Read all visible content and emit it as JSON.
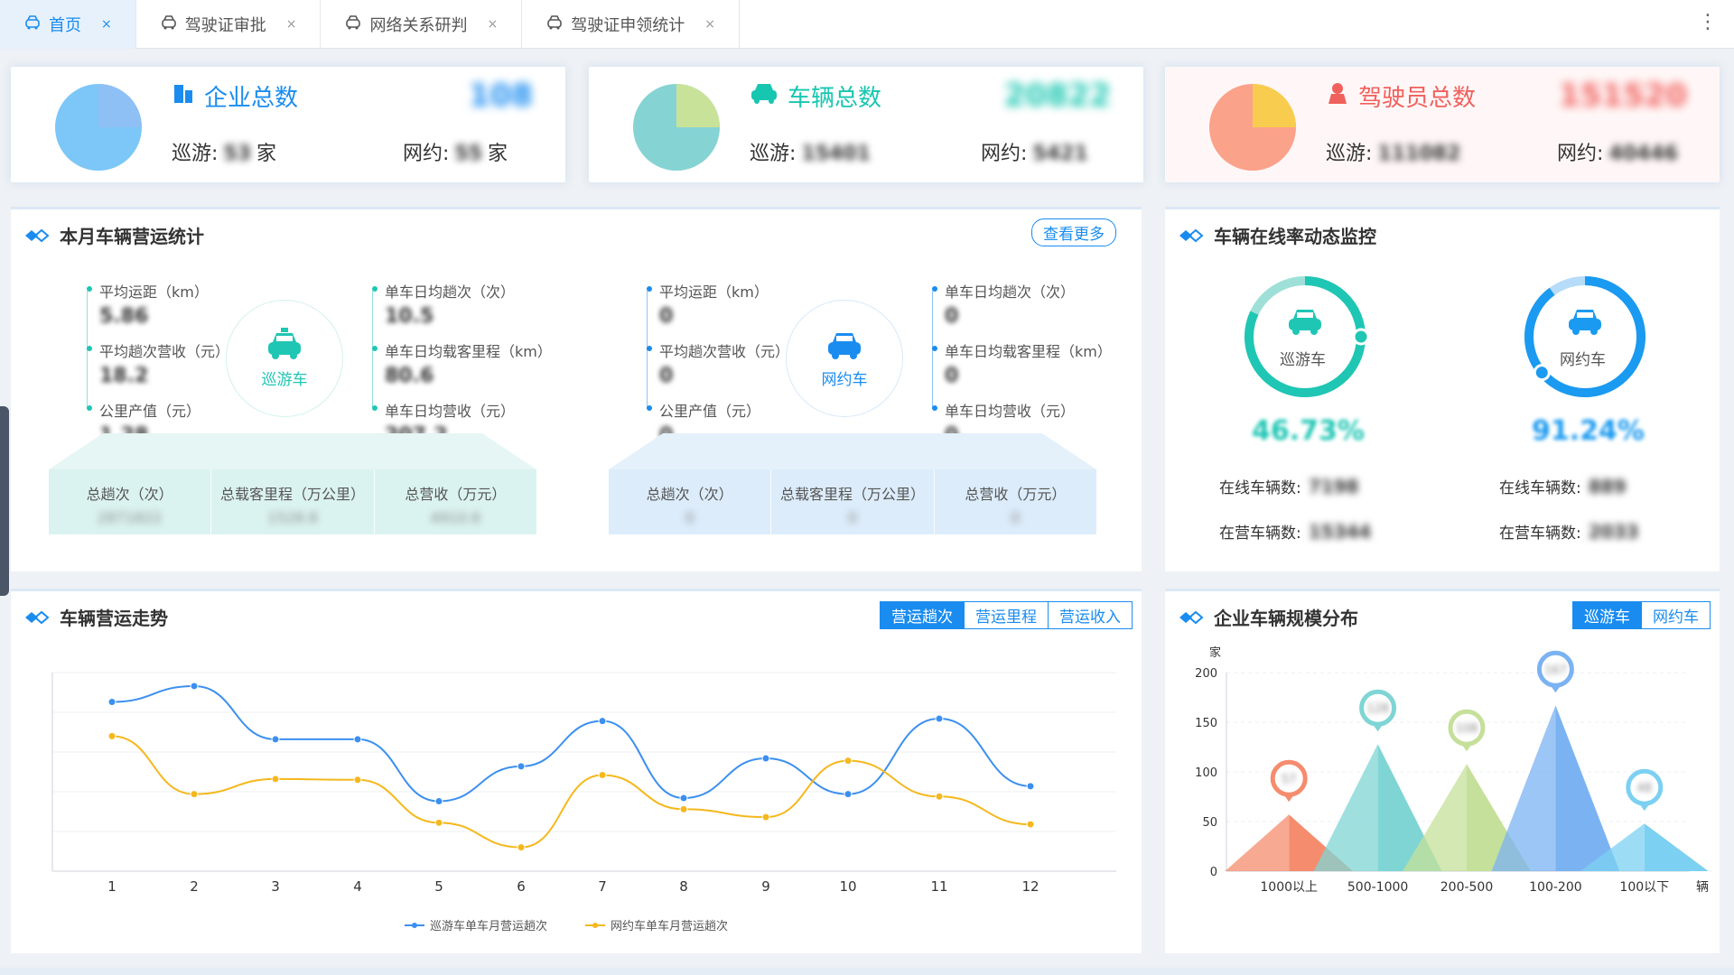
{
  "tabs": [
    {
      "label": "首页",
      "active": true
    },
    {
      "label": "驾驶证审批",
      "active": false
    },
    {
      "label": "网络关系研判",
      "active": false
    },
    {
      "label": "驾驶证申领统计",
      "active": false
    }
  ],
  "summary": [
    {
      "title": "企业总数",
      "total": "108",
      "left_label": "巡游:",
      "left_value": "53",
      "left_unit": "家",
      "right_label": "网约:",
      "right_value": "55",
      "right_unit": "家",
      "color": "#1a8cf0",
      "pie": [
        "#8ec0f5",
        "#7cc7f7"
      ]
    },
    {
      "title": "车辆总数",
      "total": "20822",
      "left_label": "巡游:",
      "left_value": "15401",
      "left_unit": "",
      "right_label": "网约:",
      "right_value": "5421",
      "right_unit": "",
      "color": "#17c6b0",
      "pie": [
        "#c8e29a",
        "#86d3d3"
      ]
    },
    {
      "title": "驾驶员总数",
      "total": "151520",
      "left_label": "巡游:",
      "left_value": "111082",
      "left_unit": "",
      "right_label": "网约:",
      "right_value": "40446",
      "right_unit": "",
      "color": "#f0605c",
      "pie": [
        "#f8cd4f",
        "#fba28a"
      ]
    }
  ],
  "ops": {
    "title": "本月车辆营运统计",
    "more": "查看更多",
    "groups": [
      {
        "name": "巡游车",
        "accent": "#1fc6b4",
        "left": [
          {
            "label": "平均运距（km）",
            "value": "5.86"
          },
          {
            "label": "平均趟次营收（元）",
            "value": "18.2"
          },
          {
            "label": "公里产值（元）",
            "value": "1.28"
          }
        ],
        "right": [
          {
            "label": "单车日均趟次（次）",
            "value": "10.5"
          },
          {
            "label": "单车日均载客里程（km）",
            "value": "80.6"
          },
          {
            "label": "单车日均营收（元）",
            "value": "207.2"
          }
        ],
        "totals": [
          {
            "label": "总趟次（次）",
            "value": "2871822"
          },
          {
            "label": "总载客里程（万公里）",
            "value": "1528.8"
          },
          {
            "label": "总营收（万元）",
            "value": "4910.6"
          }
        ]
      },
      {
        "name": "网约车",
        "accent": "#1a8cf0",
        "left": [
          {
            "label": "平均运距（km）",
            "value": "0"
          },
          {
            "label": "平均趟次营收（元）",
            "value": "0"
          },
          {
            "label": "公里产值（元）",
            "value": "0"
          }
        ],
        "right": [
          {
            "label": "单车日均趟次（次）",
            "value": "0"
          },
          {
            "label": "单车日均载客里程（km）",
            "value": "0"
          },
          {
            "label": "单车日均营收（元）",
            "value": "0"
          }
        ],
        "totals": [
          {
            "label": "总趟次（次）",
            "value": "0"
          },
          {
            "label": "总载客里程（万公里）",
            "value": "0"
          },
          {
            "label": "总营收（万元）",
            "value": "0"
          }
        ]
      }
    ]
  },
  "online": {
    "title": "车辆在线率动态监控",
    "gauges": [
      {
        "name": "巡游车",
        "pct": "46.73%",
        "pct_value": 0.82,
        "online_label": "在线车辆数:",
        "online": "7198",
        "oper_label": "在营车辆数:",
        "oper": "15344",
        "color": "#1fc6b4",
        "track": "#9ee0d8"
      },
      {
        "name": "网约车",
        "pct": "91.24%",
        "pct_value": 0.9,
        "online_label": "在线车辆数:",
        "online": "889",
        "oper_label": "在营车辆数:",
        "oper": "2033",
        "color": "#1a9af0",
        "track": "#b6dcf9"
      }
    ]
  },
  "trend": {
    "title": "车辆营运走势",
    "buttons": [
      "营运趟次",
      "营运里程",
      "营运收入"
    ],
    "active": 0
  },
  "scale": {
    "title": "企业车辆规模分布",
    "buttons": [
      "巡游车",
      "网约车"
    ],
    "active": 0
  },
  "chart_data": [
    {
      "type": "line",
      "x": [
        1,
        2,
        3,
        4,
        5,
        6,
        7,
        8,
        9,
        10,
        11,
        12
      ],
      "ylim": [
        0,
        250
      ],
      "series": [
        {
          "name": "巡游车单车月营运趟次",
          "color": "#3b8ff0",
          "values": [
            213,
            233,
            166,
            166,
            88,
            132,
            189,
            92,
            142,
            97,
            192,
            107
          ]
        },
        {
          "name": "网约车单车月营运趟次",
          "color": "#f5b81c",
          "values": [
            170,
            97,
            116,
            115,
            61,
            30,
            121,
            78,
            68,
            139,
            94,
            59
          ]
        }
      ]
    },
    {
      "type": "bar",
      "categories": [
        "1000以上",
        "500-1000",
        "200-500",
        "100-200",
        "100以下"
      ],
      "values": [
        57,
        128,
        108,
        167,
        48
      ],
      "ylabel": "家",
      "xlabel": "辆",
      "ylim": [
        0,
        200
      ],
      "yticks": [
        0,
        50,
        100,
        150,
        200
      ],
      "colors": [
        "#f58c6e",
        "#7fd5d4",
        "#c5e09a",
        "#7bb3f2",
        "#7cd0f2"
      ]
    }
  ]
}
